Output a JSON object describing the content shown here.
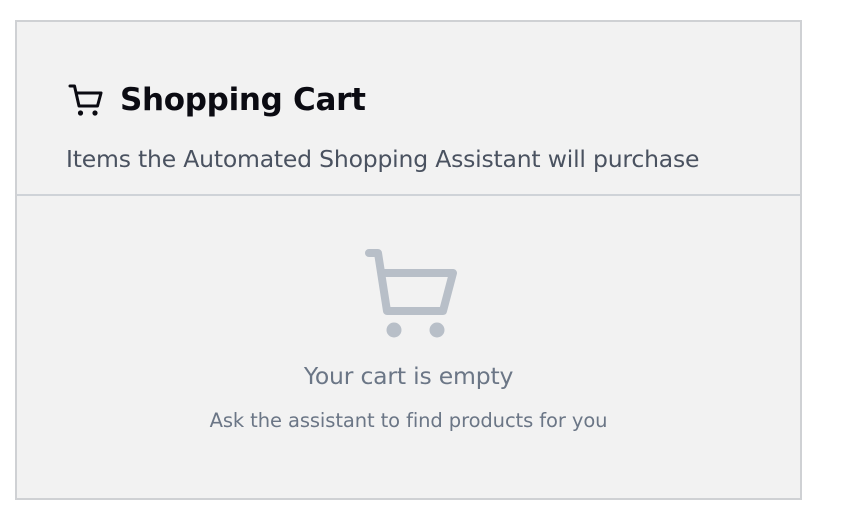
{
  "cart": {
    "title": "Shopping Cart",
    "subtitle": "Items the Automated Shopping Assistant will purchase",
    "title_icon": "shopping-cart-icon",
    "empty_state": {
      "icon": "shopping-cart-icon",
      "message": "Your cart is empty",
      "hint": "Ask the assistant to find products for you"
    }
  },
  "colors": {
    "card_background": "#f2f2f2",
    "title_text": "#0b0b12",
    "subtitle_text": "#4a5260",
    "empty_text": "#6b7686",
    "empty_icon": "#b8bfc8",
    "border": "#cfd1d4"
  }
}
